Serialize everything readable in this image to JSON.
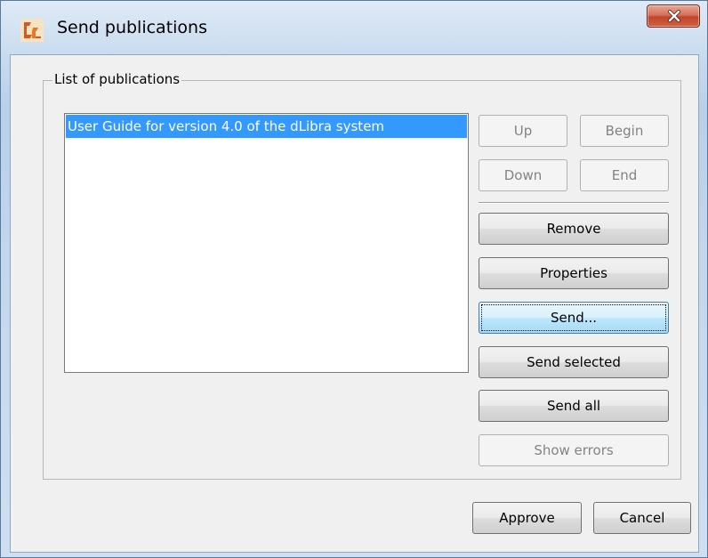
{
  "window": {
    "title": "Send publications",
    "app_icon": "dlibra-logo-icon",
    "close_icon": "close-icon"
  },
  "group": {
    "legend": "List of publications"
  },
  "publications": [
    {
      "label": "User Guide for version 4.0 of the dLibra system",
      "selected": true
    }
  ],
  "buttons": {
    "up": "Up",
    "begin": "Begin",
    "down": "Down",
    "end": "End",
    "remove": "Remove",
    "properties": "Properties",
    "send": "Send...",
    "send_selected": "Send selected",
    "send_all": "Send all",
    "show_errors": "Show errors",
    "approve": "Approve",
    "cancel": "Cancel"
  },
  "colors": {
    "selection": "#3399ff",
    "close_button": "#c2462a"
  }
}
